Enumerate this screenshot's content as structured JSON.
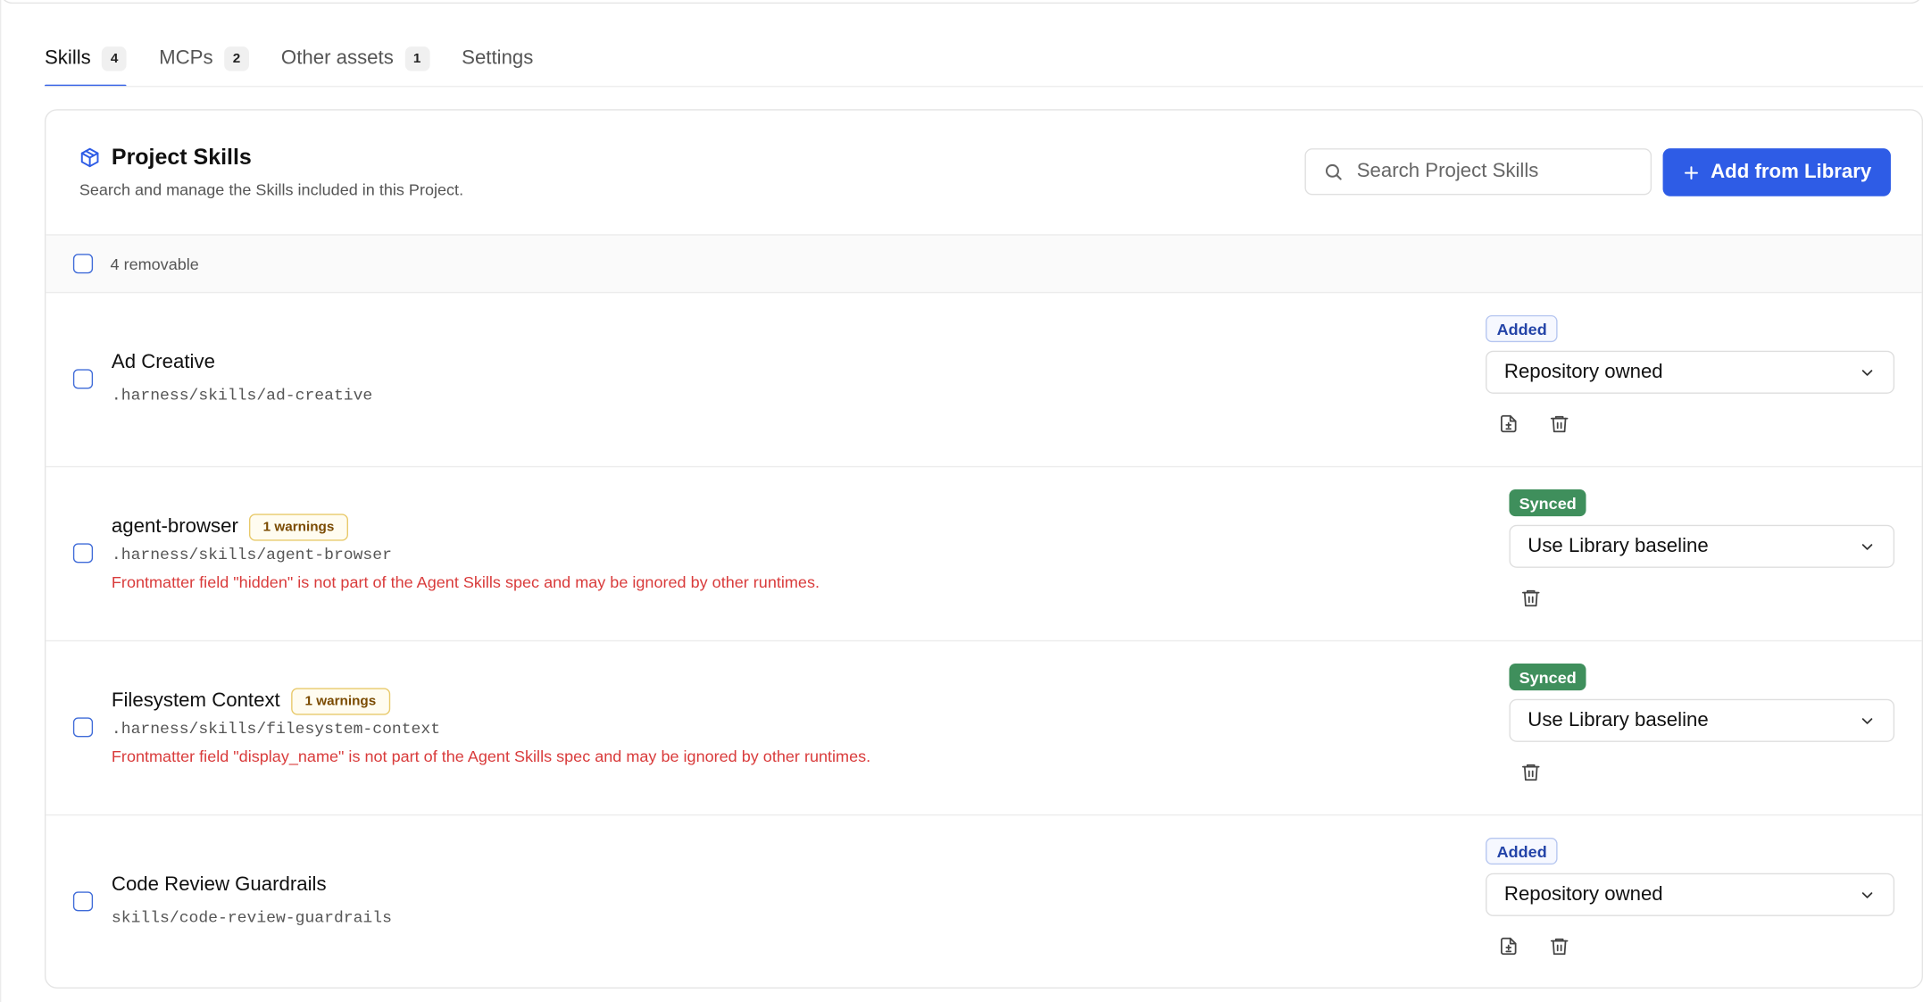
{
  "tabs": [
    {
      "label": "Skills",
      "count": "4",
      "active": true
    },
    {
      "label": "MCPs",
      "count": "2",
      "active": false
    },
    {
      "label": "Other assets",
      "count": "1",
      "active": false
    },
    {
      "label": "Settings",
      "count": "",
      "active": false
    }
  ],
  "panel": {
    "title": "Project Skills",
    "subtitle": "Search and manage the Skills included in this Project.",
    "icon": "package-icon",
    "search_placeholder": "Search Project Skills",
    "add_button_label": "Add from Library",
    "select_all_label": "4 removable"
  },
  "skills": [
    {
      "name": "Ad Creative",
      "path": ".harness/skills/ad-creative",
      "warning_badge": "",
      "warning_text": "",
      "status": "Added",
      "ownership": "Repository owned",
      "actions": [
        "file-diff-icon",
        "trash-icon"
      ]
    },
    {
      "name": "agent-browser",
      "path": ".harness/skills/agent-browser",
      "warning_badge": "1 warnings",
      "warning_text": "Frontmatter field \"hidden\" is not part of the Agent Skills spec and may be ignored by other runtimes.",
      "status": "Synced",
      "ownership": "Use Library baseline",
      "actions": [
        "trash-icon"
      ]
    },
    {
      "name": "Filesystem Context",
      "path": ".harness/skills/filesystem-context",
      "warning_badge": "1 warnings",
      "warning_text": "Frontmatter field \"display_name\" is not part of the Agent Skills spec and may be ignored by other runtimes.",
      "status": "Synced",
      "ownership": "Use Library baseline",
      "actions": [
        "trash-icon"
      ]
    },
    {
      "name": "Code Review Guardrails",
      "path": "skills/code-review-guardrails",
      "warning_badge": "",
      "warning_text": "",
      "status": "Added",
      "ownership": "Repository owned",
      "actions": [
        "file-diff-icon",
        "trash-icon"
      ]
    }
  ],
  "colors": {
    "accent": "#2e5ce6",
    "synced": "#3f8f5c",
    "warning_text": "#d93b3b",
    "warning_badge_border": "#e8c96a"
  }
}
